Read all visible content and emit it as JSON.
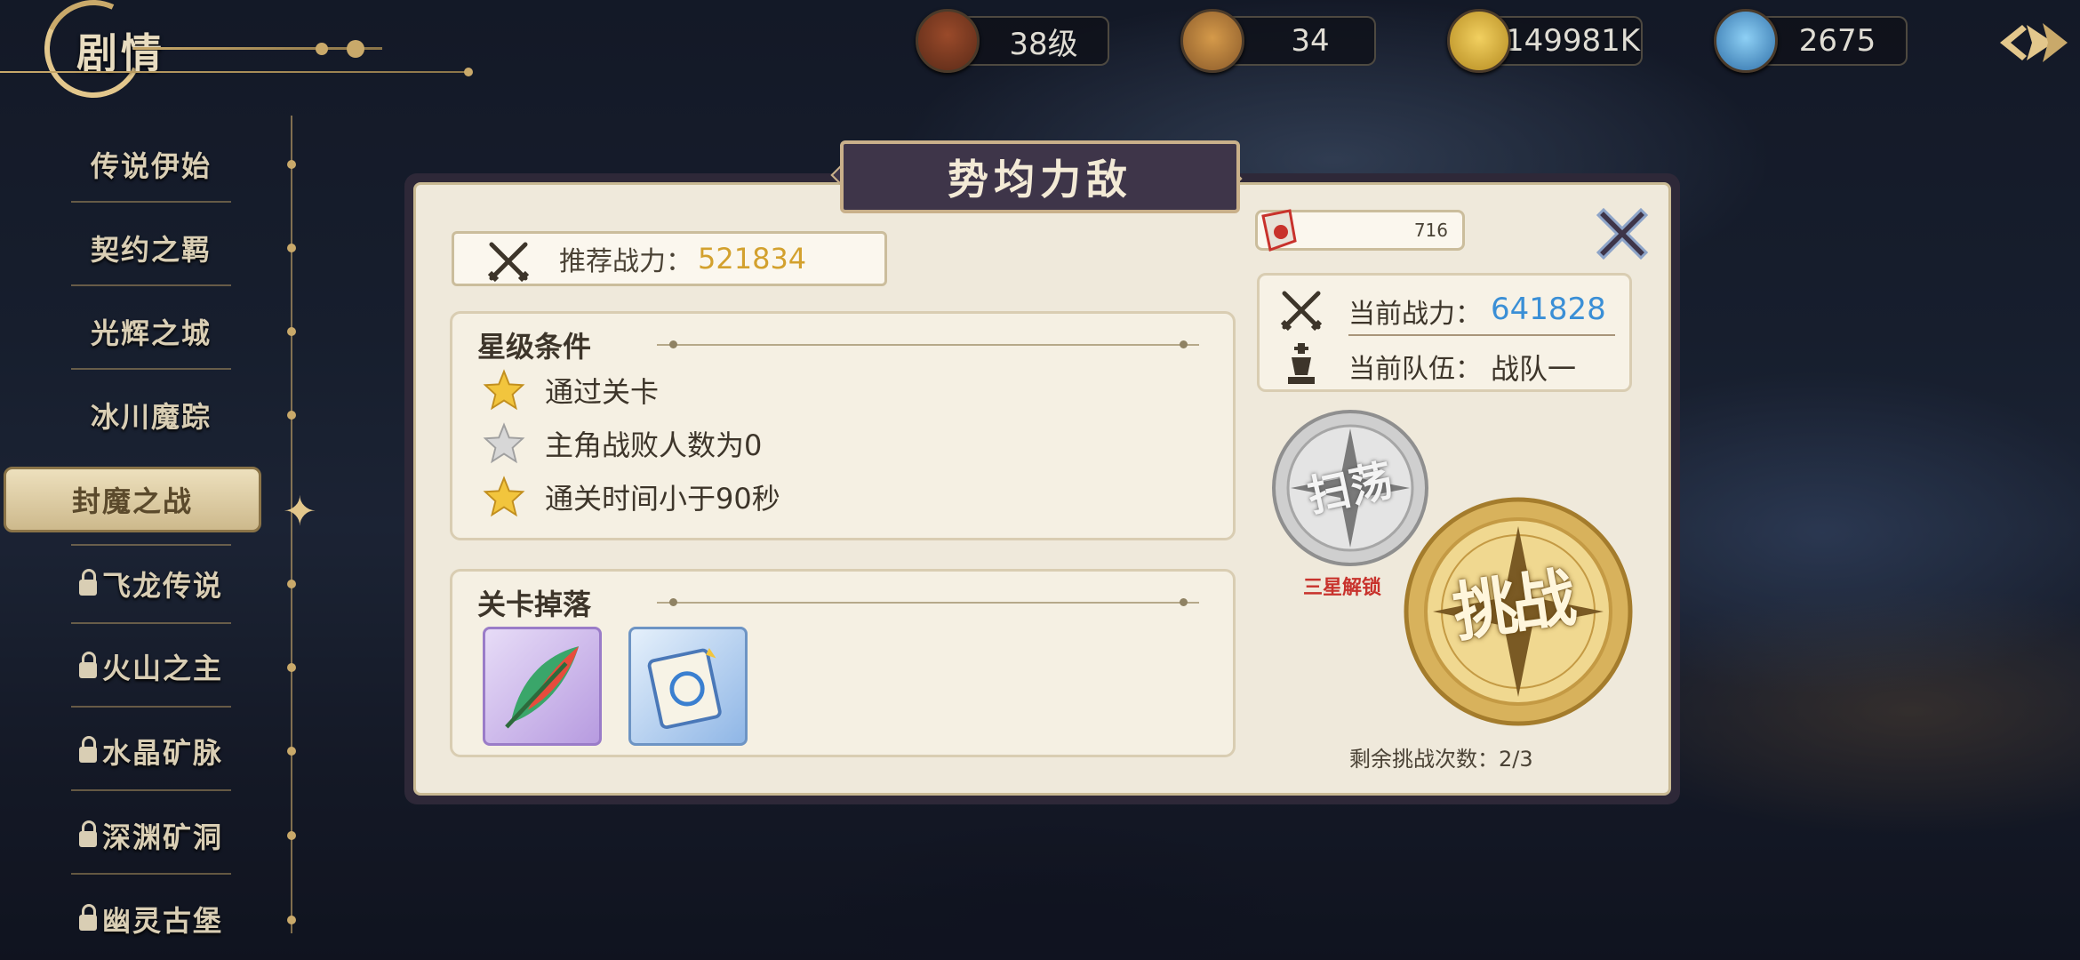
{
  "header": {
    "title": "剧情"
  },
  "resources": [
    {
      "name": "level",
      "value": "38级",
      "icon": "treasure-chest-icon"
    },
    {
      "name": "stamina",
      "value": "34",
      "icon": "bread-icon"
    },
    {
      "name": "gold",
      "value": "149981K",
      "icon": "gold-coin-icon"
    },
    {
      "name": "diamond",
      "value": "2675",
      "icon": "diamond-icon"
    }
  ],
  "sidebar": {
    "chapters": [
      {
        "label": "传说伊始",
        "locked": false
      },
      {
        "label": "契约之羁",
        "locked": false
      },
      {
        "label": "光辉之城",
        "locked": false
      },
      {
        "label": "冰川魔踪",
        "locked": false
      },
      {
        "label": "封魔之战",
        "locked": false,
        "active": true
      },
      {
        "label": "飞龙传说",
        "locked": true
      },
      {
        "label": "火山之主",
        "locked": true
      },
      {
        "label": "水晶矿脉",
        "locked": true
      },
      {
        "label": "深渊矿洞",
        "locked": true
      },
      {
        "label": "幽灵古堡",
        "locked": true
      }
    ]
  },
  "modal": {
    "title": "势均力敌",
    "recommended_power_label": "推荐战力：",
    "recommended_power_value": "521834",
    "energy_value": "716",
    "star_conditions": {
      "title": "星级条件",
      "items": [
        {
          "text": "通过关卡",
          "achieved": true
        },
        {
          "text": "主角战败人数为0",
          "achieved": false
        },
        {
          "text": "通关时间小于90秒",
          "achieved": true
        }
      ]
    },
    "drops": {
      "title": "关卡掉落",
      "items": [
        {
          "name": "feather-item",
          "rarity_color": "#b79be0"
        },
        {
          "name": "skill-book-item",
          "rarity_color": "#8fb6e6"
        }
      ]
    },
    "team": {
      "power_label": "当前战力：",
      "power_value": "641828",
      "team_label": "当前队伍：",
      "team_value": "战队一"
    },
    "sweep": {
      "label": "扫荡",
      "note": "三星解锁"
    },
    "challenge": {
      "label": "挑战"
    },
    "remaining": "剩余挑战次数：2/3"
  },
  "colors": {
    "gold": "#d3a12e",
    "blue": "#3a8fd6",
    "red": "#c8322c",
    "panel": "#efe9db"
  }
}
